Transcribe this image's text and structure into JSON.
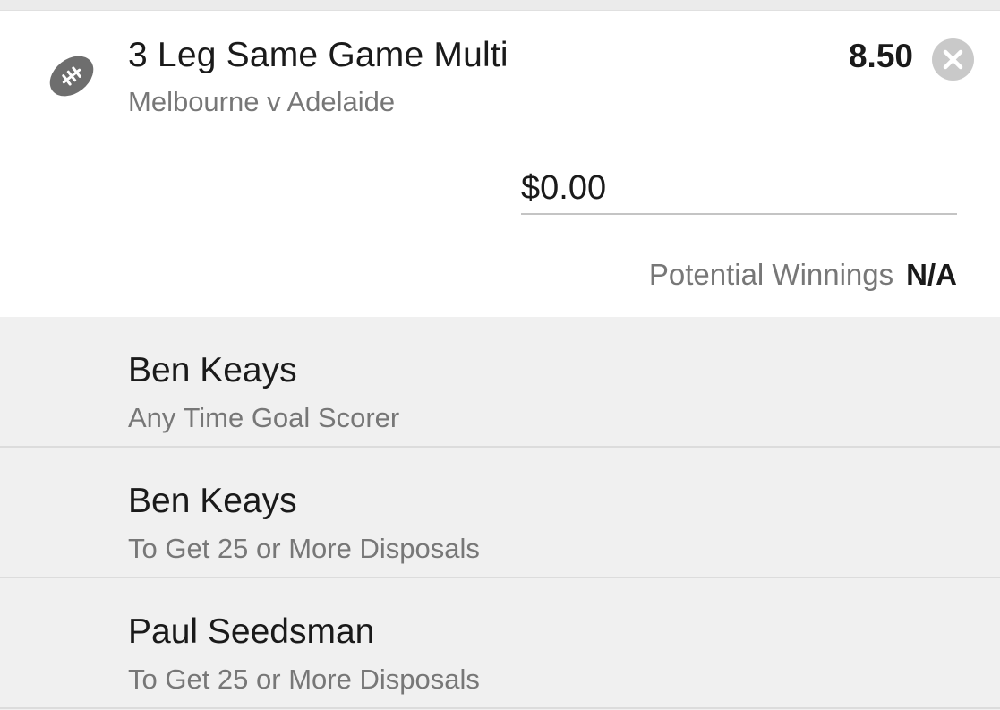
{
  "bet": {
    "title": "3 Leg Same Game Multi",
    "event": "Melbourne v Adelaide",
    "odds": "8.50",
    "sport_icon": "football-icon",
    "close_icon": "close-icon"
  },
  "stake": {
    "value": "$0.00"
  },
  "winnings": {
    "label": "Potential Winnings",
    "value": "N/A"
  },
  "legs": [
    {
      "player": "Ben Keays",
      "market": "Any Time Goal Scorer"
    },
    {
      "player": "Ben Keays",
      "market": "To Get 25 or More Disposals"
    },
    {
      "player": "Paul Seedsman",
      "market": "To Get 25 or More Disposals"
    }
  ],
  "colors": {
    "icon": "#6e6e6e",
    "close_bg": "#c9c9c9",
    "muted_text": "#777777",
    "leg_bg": "#f0f0f0"
  }
}
